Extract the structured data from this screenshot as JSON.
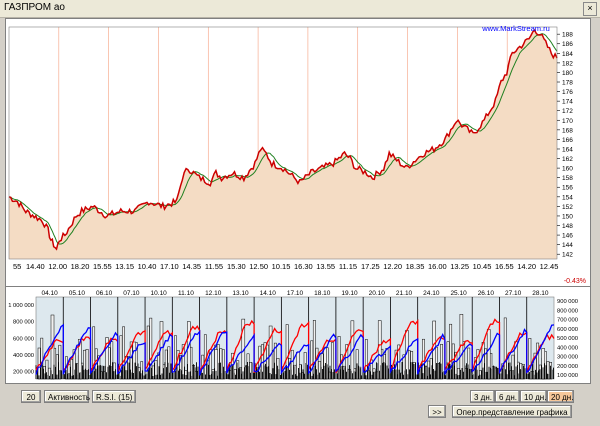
{
  "window": {
    "title": "ГАЗПРОМ ао",
    "close_glyph": "×"
  },
  "price_panel": {
    "watermark": "www.MarkStream.ru",
    "y_ticks": [
      "188",
      "186",
      "184",
      "182",
      "180",
      "178",
      "176",
      "174",
      "172",
      "170",
      "168",
      "166",
      "164",
      "162",
      "160",
      "158",
      "156",
      "154",
      "152",
      "150",
      "148",
      "146",
      "144",
      "142"
    ],
    "x_ticks": [
      "55",
      "14.40",
      "12.00",
      "18.20",
      "15.55",
      "13.15",
      "10.40",
      "17.10",
      "14.35",
      "11.55",
      "15.30",
      "12.50",
      "10.15",
      "16.30",
      "13.55",
      "11.15",
      "17.25",
      "12.20",
      "18.35",
      "16.00",
      "13.25",
      "10.45",
      "16.55",
      "14.20",
      "12.45"
    ],
    "change_label": "-0.43%"
  },
  "volume_panel": {
    "date_labels": [
      "04.10",
      "05.10",
      "06.10",
      "07.10",
      "10.10",
      "11.10",
      "12.10",
      "13.10",
      "14.10",
      "17.10",
      "18.10",
      "19.10",
      "20.10",
      "21.10",
      "24.10",
      "25.10",
      "26.10",
      "27.10",
      "28.10"
    ],
    "y_left": [
      "1 000 000",
      "800 000",
      "600 000",
      "400 000",
      "200 000"
    ],
    "y_right": [
      "900 000",
      "800 000",
      "700 000",
      "600 000",
      "500 000",
      "400 000",
      "300 000",
      "200 000",
      "100 000"
    ]
  },
  "controls": {
    "period_value": "20",
    "activity_label": "Активность",
    "rsi_label": "R.S.I. (15)",
    "range_buttons": [
      {
        "label": "3 дн.",
        "active": false
      },
      {
        "label": "6 дн.",
        "active": false
      },
      {
        "label": "10 дн.",
        "active": false
      },
      {
        "label": "20 дн.",
        "active": true
      }
    ],
    "nav_label": ">>",
    "view_label": "Опер.представление графика"
  },
  "chart_data": {
    "type": "line",
    "price_points": [
      [
        0,
        154
      ],
      [
        3,
        153
      ],
      [
        6,
        151
      ],
      [
        9,
        150
      ],
      [
        12,
        149
      ],
      [
        14,
        147
      ],
      [
        15,
        145
      ],
      [
        16,
        144
      ],
      [
        17,
        143
      ],
      [
        18,
        145
      ],
      [
        20,
        146
      ],
      [
        22,
        148
      ],
      [
        24,
        150
      ],
      [
        26,
        151
      ],
      [
        30,
        152
      ],
      [
        35,
        150
      ],
      [
        40,
        151
      ],
      [
        45,
        151
      ],
      [
        50,
        153
      ],
      [
        55,
        152
      ],
      [
        60,
        153
      ],
      [
        62,
        158
      ],
      [
        64,
        160
      ],
      [
        66,
        159
      ],
      [
        68,
        158
      ],
      [
        72,
        157
      ],
      [
        74,
        159
      ],
      [
        76,
        158
      ],
      [
        80,
        159
      ],
      [
        84,
        158
      ],
      [
        88,
        161
      ],
      [
        90,
        164
      ],
      [
        92,
        163
      ],
      [
        94,
        161
      ],
      [
        98,
        160
      ],
      [
        100,
        159
      ],
      [
        104,
        157
      ],
      [
        108,
        159
      ],
      [
        112,
        160
      ],
      [
        116,
        161
      ],
      [
        118,
        162
      ],
      [
        120,
        163
      ],
      [
        122,
        162
      ],
      [
        124,
        160
      ],
      [
        128,
        159
      ],
      [
        130,
        158
      ],
      [
        134,
        160
      ],
      [
        136,
        163
      ],
      [
        138,
        162
      ],
      [
        140,
        161
      ],
      [
        142,
        160
      ],
      [
        144,
        161
      ],
      [
        148,
        163
      ],
      [
        152,
        164
      ],
      [
        156,
        166
      ],
      [
        158,
        168
      ],
      [
        160,
        170
      ],
      [
        162,
        169
      ],
      [
        164,
        168
      ],
      [
        166,
        167
      ],
      [
        170,
        170
      ],
      [
        174,
        174
      ],
      [
        176,
        178
      ],
      [
        178,
        180
      ],
      [
        180,
        184
      ],
      [
        184,
        186
      ],
      [
        186,
        187
      ],
      [
        188,
        189
      ],
      [
        190,
        188
      ],
      [
        192,
        186
      ],
      [
        194,
        184
      ],
      [
        196,
        183
      ]
    ],
    "x_range": [
      0,
      196
    ],
    "ylim": [
      141,
      189.5
    ],
    "series": [
      {
        "name": "",
        "color": "#cc0000"
      },
      {
        "name": "",
        "color": "#208020"
      }
    ],
    "volume_sessions": 19,
    "colors": {
      "red_line": "#ff0000",
      "blue_line": "#0000ff",
      "fill": "#f4dcc4"
    }
  }
}
